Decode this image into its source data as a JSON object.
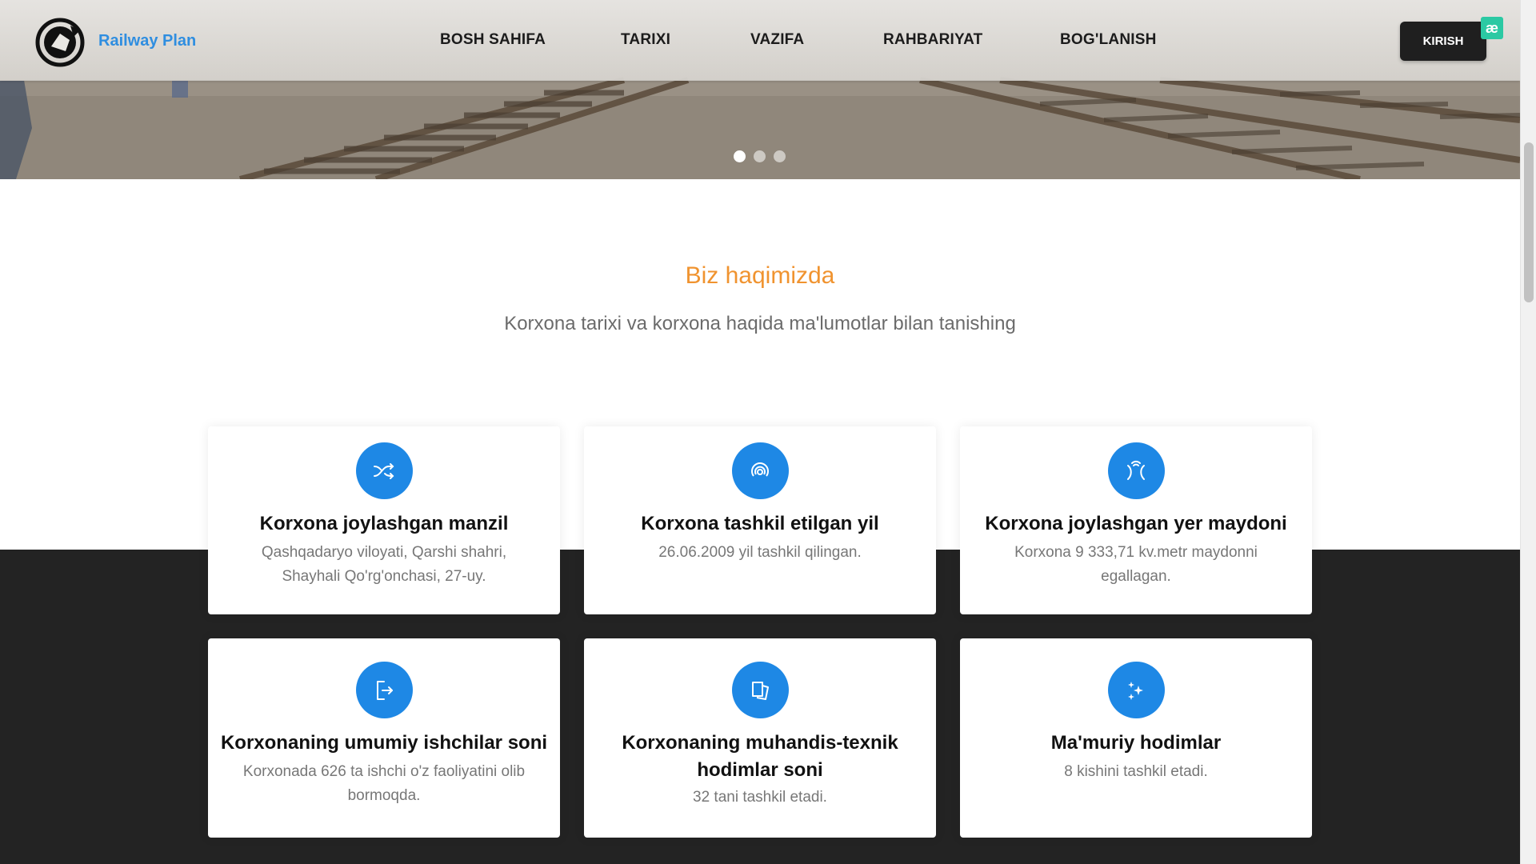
{
  "brand": {
    "name": "Railway Plan"
  },
  "nav": {
    "items": [
      {
        "label": "BOSH SAHIFA"
      },
      {
        "label": "TARIXI"
      },
      {
        "label": "VAZIFA"
      },
      {
        "label": "RAHBARIYAT"
      },
      {
        "label": "BOG'LANISH"
      }
    ],
    "login_label": "KIRISH",
    "extension_badge": "æ"
  },
  "slider": {
    "slide_count": 3,
    "active_index": 0
  },
  "about": {
    "title": "Biz haqimizda",
    "subtitle": "Korxona tarixi va korxona haqida ma'lumotlar bilan tanishing"
  },
  "cards": [
    {
      "icon": "shuffle-icon",
      "title": "Korxona joylashgan manzil",
      "text": "Qashqadaryo viloyati, Qarshi shahri, Shayhali Qo'rg'onchasi, 27-uy."
    },
    {
      "icon": "target-icon",
      "title": "Korxona tashkil etilgan yil",
      "text": "26.06.2009 yil tashkil qilingan."
    },
    {
      "icon": "area-icon",
      "title": "Korxona joylashgan yer maydoni",
      "text": "Korxona 9 333,71 kv.metr maydonni egallagan."
    },
    {
      "icon": "exit-icon",
      "title": "Korxonaning umumiy ishchilar soni",
      "text": "Korxonada 626 ta ishchi o'z faoliyatini olib bormoqda."
    },
    {
      "icon": "tablet-icon",
      "title": "Korxonaning muhandis-texnik hodimlar soni",
      "text": "32 tani tashkil etadi."
    },
    {
      "icon": "sparkles-icon",
      "title": "Ma'muriy hodimlar",
      "text": "8 kishini tashkil etadi."
    }
  ],
  "colors": {
    "accent": "#1e88e5",
    "brand": "#2f8ee0",
    "title": "#f0932f",
    "dark_band": "#232323"
  }
}
